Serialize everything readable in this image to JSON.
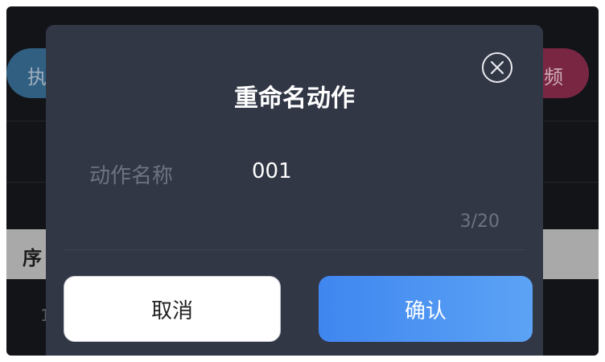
{
  "background": {
    "left_button_label": "执",
    "right_button_label": "频",
    "table_header_first": "序",
    "row_first_index": "1"
  },
  "dialog": {
    "title": "重命名动作",
    "field_label": "动作名称",
    "field_value": "001",
    "char_count": "3/20",
    "cancel_label": "取消",
    "confirm_label": "确认"
  },
  "icons": {
    "close": "close-circle-icon"
  },
  "colors": {
    "dialog_bg": "#323746",
    "confirm_start": "#3f86f0",
    "confirm_end": "#5ca3f5",
    "muted_text": "#6e7380"
  }
}
